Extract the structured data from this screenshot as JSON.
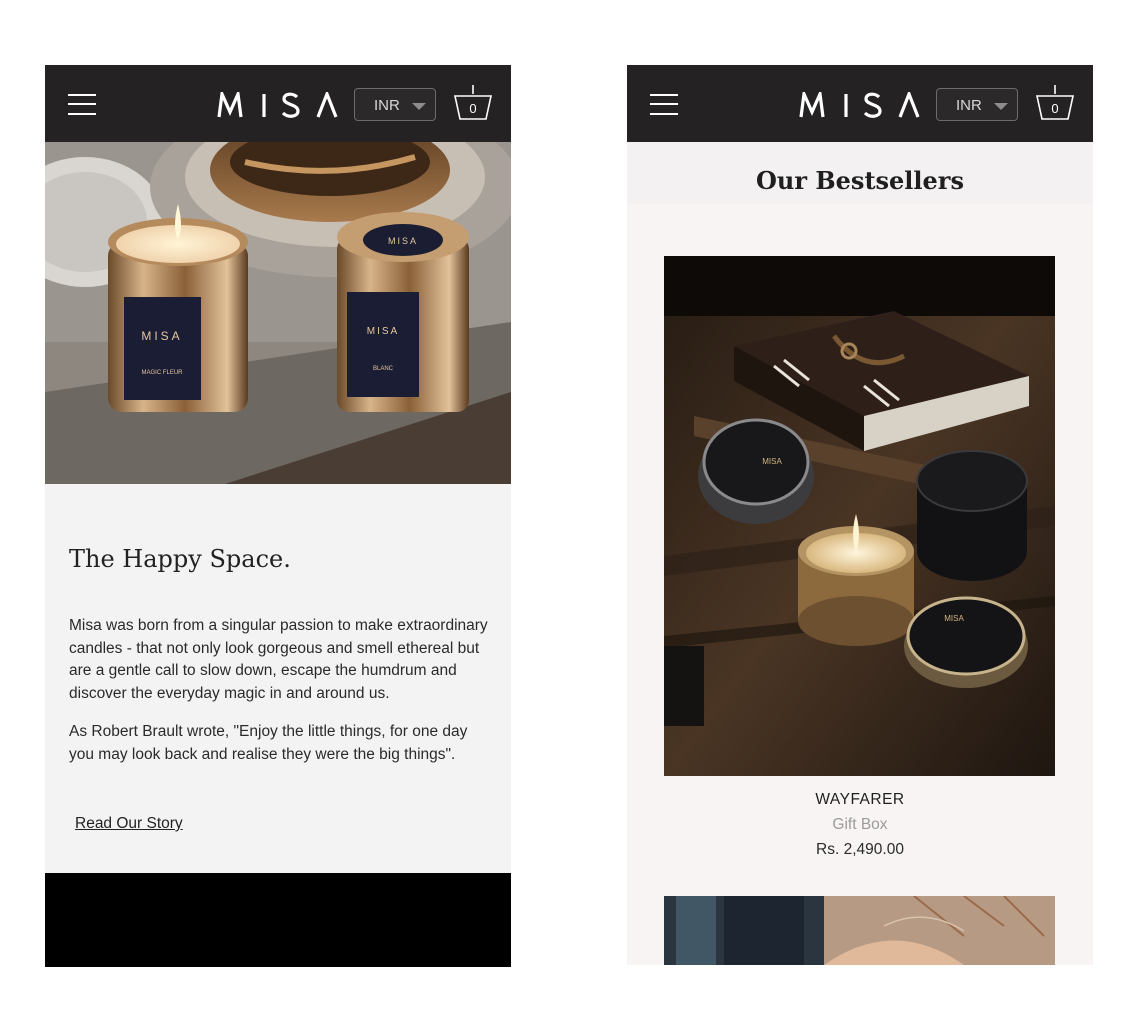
{
  "brand": {
    "logo_text": "MISA"
  },
  "header": {
    "currency": "INR",
    "cart_count": "0"
  },
  "left_screen": {
    "section_title": "The Happy Space.",
    "paragraphs": [
      "Misa was born from a singular passion to make extraordinary candles - that not only look gorgeous and smell ethereal but are a gentle call to slow down, escape the humdrum and discover the everyday magic in and around us.",
      "As Robert Brault wrote, \"Enjoy the little things, for one day you may look back and realise they were the big things\"."
    ],
    "link": "Read Our Story",
    "hero_candle_labels": [
      "MISA",
      "MAGIC FLEUR",
      "MISA",
      "BLANC"
    ]
  },
  "right_screen": {
    "section_title": "Our Bestsellers",
    "product": {
      "name": "WAYFARER",
      "type": "Gift Box",
      "price": "Rs. 2,490.00"
    }
  },
  "colors": {
    "header_bg": "#242222",
    "page_bg_left": "#f4f3f3",
    "page_bg_right": "#f8f4f4"
  }
}
